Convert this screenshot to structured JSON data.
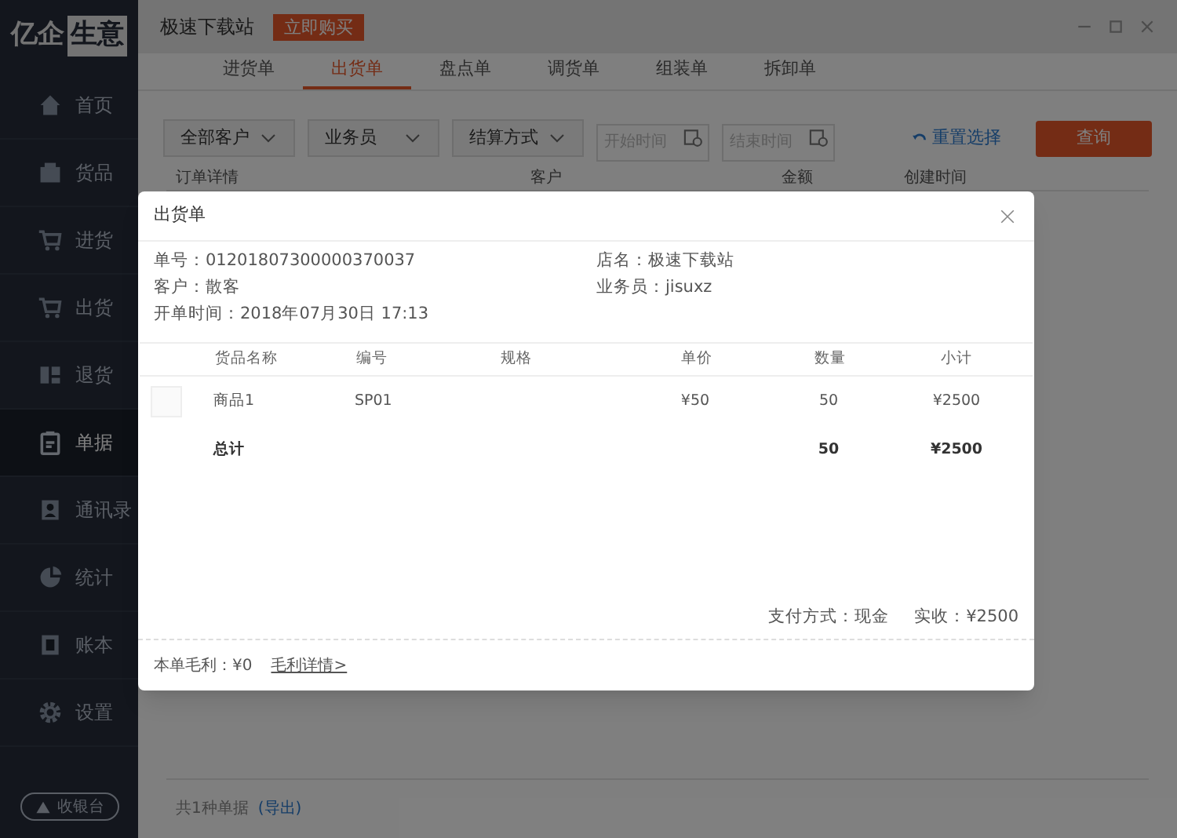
{
  "app": {
    "logo": {
      "part_1": "亿企",
      "part_2": "生意"
    },
    "shop_name": "极速下载站",
    "buy_button": "立即购买"
  },
  "sidebar": {
    "items": [
      {
        "label": "首页",
        "selected": false
      },
      {
        "label": "货品",
        "selected": false
      },
      {
        "label": "进货",
        "selected": false
      },
      {
        "label": "出货",
        "selected": false
      },
      {
        "label": "退货",
        "selected": false
      },
      {
        "label": "单据",
        "selected": true
      },
      {
        "label": "通讯录",
        "selected": false
      },
      {
        "label": "统计",
        "selected": false
      },
      {
        "label": "账本",
        "selected": false
      },
      {
        "label": "设置",
        "selected": false
      }
    ],
    "cashier_button": "收银台"
  },
  "tabs": [
    {
      "label": "进货单",
      "selected": false
    },
    {
      "label": "出货单",
      "selected": true
    },
    {
      "label": "盘点单",
      "selected": false
    },
    {
      "label": "调货单",
      "selected": false
    },
    {
      "label": "组装单",
      "selected": false
    },
    {
      "label": "拆卸单",
      "selected": false
    }
  ],
  "filters": {
    "dropdowns": [
      "全部客户",
      "业务员",
      "结算方式"
    ],
    "start_date": {
      "placeholder": "开始时间"
    },
    "end_date": {
      "placeholder": "结束时间"
    },
    "reset": "重置选择",
    "query": "查询"
  },
  "table": {
    "columns": [
      "订单详情",
      "客户",
      "金额",
      "创建时间"
    ]
  },
  "footer": {
    "count": "共1种单据",
    "export": "(导出)"
  },
  "dialog": {
    "title": "出货单",
    "info_left": [
      "单号：01201807300000370037",
      "客户：散客",
      "开单时间：2018年07月30日 17:13"
    ],
    "info_right": [
      "店名：极速下载站",
      "业务员：jisuxz"
    ],
    "columns": [
      "货品名称",
      "编号",
      "规格",
      "单价",
      "数量",
      "小计"
    ],
    "rows": [
      {
        "name": "商品1",
        "code": "SP01",
        "price": "¥50",
        "qty": "50",
        "subtotal": "¥2500"
      }
    ],
    "total": {
      "label": "总计",
      "qty": "50",
      "subtotal": "¥2500"
    },
    "payment": "支付方式：现金",
    "received": "实收：¥2500",
    "profit": "本单毛利：¥0",
    "profit_link": "毛利详情>"
  }
}
